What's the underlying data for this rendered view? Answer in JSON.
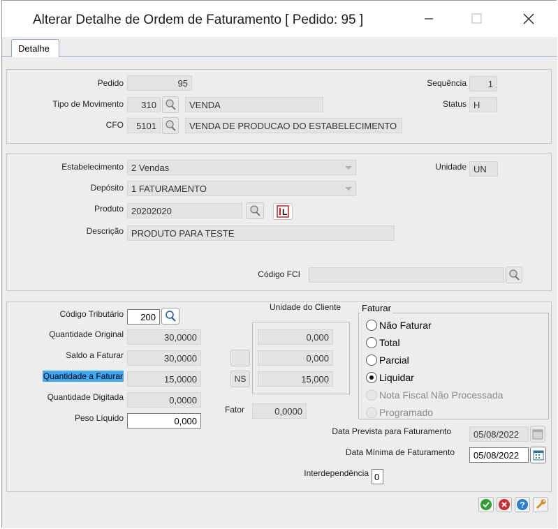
{
  "window": {
    "title": "Alterar Detalhe de Ordem de Faturamento [ Pedido: 95 ]",
    "controls": [
      "minimize-icon",
      "maximize-icon",
      "close-icon"
    ]
  },
  "tabs": [
    {
      "label": "Detalhe",
      "active": true
    }
  ],
  "header_section": {
    "pedido_label": "Pedido",
    "pedido_value": "95",
    "tipo_movimento_label": "Tipo de Movimento",
    "tipo_movimento_code": "310",
    "tipo_movimento_desc": "VENDA",
    "cfo_label": "CFO",
    "cfo_code": "5101",
    "cfo_desc": "VENDA DE PRODUCAO DO ESTABELECIMENTO",
    "sequencia_label": "Sequência",
    "sequencia_value": "1",
    "status_label": "Status",
    "status_value": "H"
  },
  "product_section": {
    "estabelecimento_label": "Estabelecimento",
    "estabelecimento_value": "2 Vendas",
    "deposito_label": "Depósito",
    "deposito_value": "1 FATURAMENTO",
    "produto_label": "Produto",
    "produto_value": "20202020",
    "descricao_label": "Descrição",
    "descricao_value": "PRODUTO PARA TESTE",
    "unidade_label": "Unidade",
    "unidade_value": "UN",
    "codigo_fci_label": "Código FCI",
    "codigo_fci_value": ""
  },
  "quantity_section": {
    "codigo_tributario_label": "Código Tributário",
    "codigo_tributario_value": "200",
    "quantidade_original_label": "Quantidade Original",
    "quantidade_original_value": "30,0000",
    "saldo_faturar_label": "Saldo a Faturar",
    "saldo_faturar_value": "30,0000",
    "quantidade_faturar_label": "Quantidade a Faturar",
    "quantidade_faturar_value": "15,0000",
    "quantidade_digitada_label": "Quantidade Digitada",
    "quantidade_digitada_value": "0,0000",
    "peso_liquido_label": "Peso Líquido",
    "peso_liquido_value": "0,000",
    "unidade_cliente_label": "Unidade do Cliente",
    "cliente_values": [
      "0,000",
      "0,000",
      "15,000"
    ],
    "ns_button_label": "NS",
    "fator_label": "Fator",
    "fator_value": "0,0000",
    "faturar_group_title": "Faturar",
    "faturar_options": [
      {
        "label": "Não Faturar",
        "checked": false,
        "disabled": false
      },
      {
        "label": "Total",
        "checked": false,
        "disabled": false
      },
      {
        "label": "Parcial",
        "checked": false,
        "disabled": false
      },
      {
        "label": "Liquidar",
        "checked": true,
        "disabled": false
      },
      {
        "label": "Nota Fiscal Não Processada",
        "checked": false,
        "disabled": true
      },
      {
        "label": "Programado",
        "checked": false,
        "disabled": true
      }
    ],
    "data_prevista_label": "Data Prevista para Faturamento",
    "data_prevista_value": "05/08/2022",
    "data_minima_label": "Data Mínima de Faturamento",
    "data_minima_value": "05/08/2022",
    "interdependencia_label": "Interdependência",
    "interdependencia_value": "0"
  },
  "action_buttons": [
    {
      "name": "confirm-icon",
      "color": "#2e9e2e"
    },
    {
      "name": "cancel-icon",
      "color": "#d42a2a"
    },
    {
      "name": "help-icon",
      "color": "#2b7ed8"
    },
    {
      "name": "tools-icon",
      "color": "#e08a1a"
    }
  ],
  "colors": {
    "highlight": "#3fa9f5",
    "panel_bg": "#ededed",
    "field_bg": "#e3e3e3"
  }
}
